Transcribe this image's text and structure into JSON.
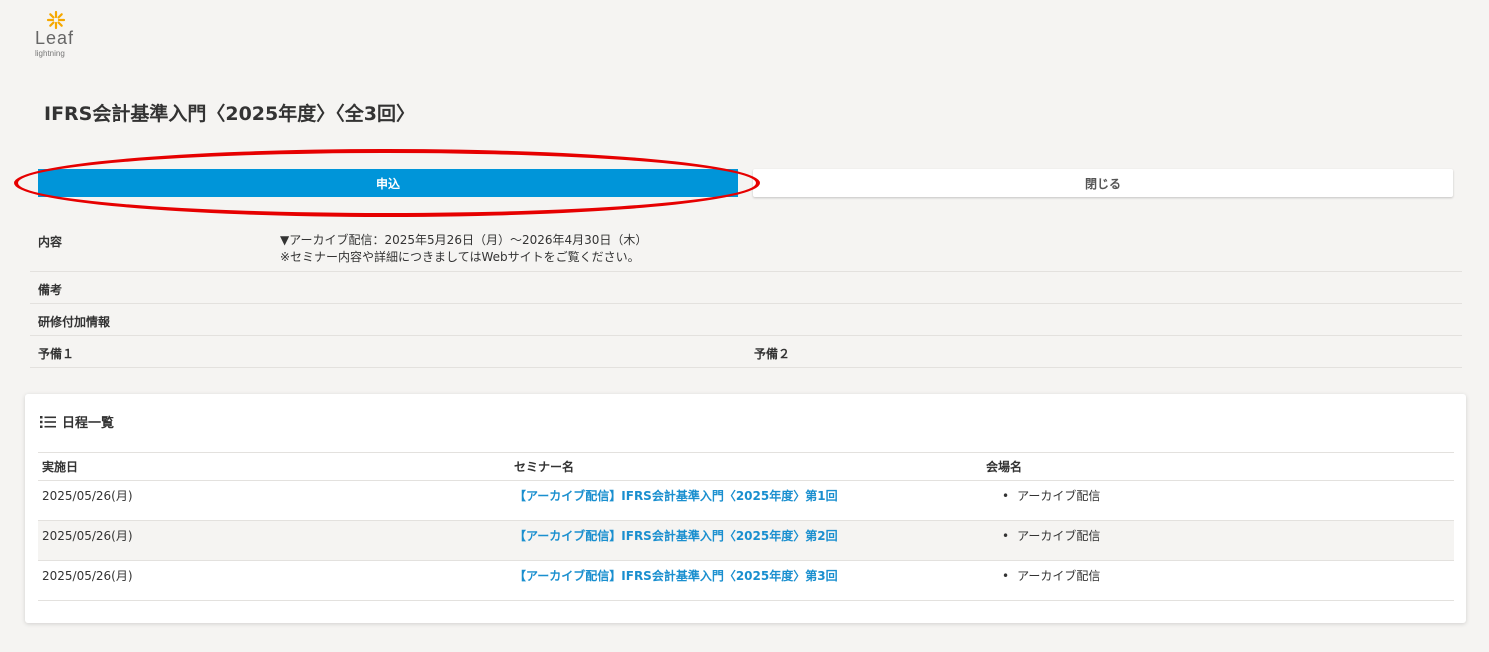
{
  "logo": {
    "name": "Leaf",
    "sub": "lightning"
  },
  "title": "IFRS会計基準入門〈2025年度〉〈全3回〉",
  "buttons": {
    "apply": "申込",
    "close": "閉じる"
  },
  "info": {
    "content_label": "内容",
    "content_line1": "▼アーカイブ配信：2025年5月26日（月）〜2026年4月30日（木）",
    "content_line2": "※セミナー内容や詳細につきましてはWebサイトをご覧ください。",
    "remarks_label": "備考",
    "training_label": "研修付加情報",
    "spare1_label": "予備１",
    "spare2_label": "予備２"
  },
  "schedule": {
    "heading": "日程一覧",
    "columns": [
      "実施日",
      "セミナー名",
      "会場名"
    ],
    "rows": [
      {
        "date": "2025/05/26(月)",
        "seminar": "【アーカイブ配信】IFRS会計基準入門〈2025年度〉第1回",
        "venue": "アーカイブ配信"
      },
      {
        "date": "2025/05/26(月)",
        "seminar": "【アーカイブ配信】IFRS会計基準入門〈2025年度〉第2回",
        "venue": "アーカイブ配信"
      },
      {
        "date": "2025/05/26(月)",
        "seminar": "【アーカイブ配信】IFRS会計基準入門〈2025年度〉第3回",
        "venue": "アーカイブ配信"
      }
    ]
  },
  "colors": {
    "primary": "#0095d9",
    "link": "#1a8fcf",
    "highlight": "#e60000",
    "logo_accent": "#f5a800"
  },
  "icons": {
    "logo": "sun-leaf-icon",
    "list": "list-icon"
  }
}
